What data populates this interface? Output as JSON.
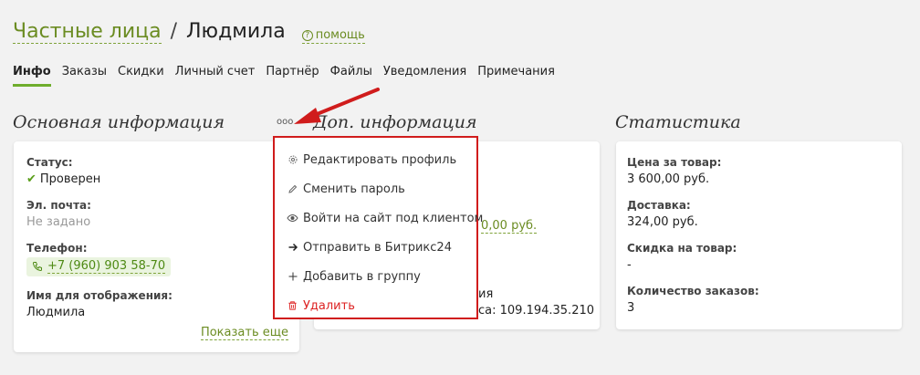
{
  "breadcrumb": {
    "parent": "Частные лица",
    "separator": "/",
    "current": "Людмила",
    "help_icon": "?",
    "help_label": "помощь"
  },
  "tabs": [
    {
      "label": "Инфо",
      "active": true
    },
    {
      "label": "Заказы"
    },
    {
      "label": "Скидки"
    },
    {
      "label": "Личный счет"
    },
    {
      "label": "Партнёр"
    },
    {
      "label": "Файлы"
    },
    {
      "label": "Уведомления"
    },
    {
      "label": "Примечания"
    }
  ],
  "main_info": {
    "title": "Основная информация",
    "status_label": "Статус:",
    "status_value": "Проверен",
    "email_label": "Эл. почта:",
    "email_value": "Не задано",
    "phone_label": "Телефон:",
    "phone_value": "+7 (960) 903 58-70",
    "display_name_label": "Имя для отображения:",
    "display_name_value": "Людмила",
    "show_more": "Показать еще",
    "menu_dots": "ooo"
  },
  "extra_info": {
    "title": "Доп. информация",
    "partial_amount": "0,00 руб.",
    "partial_label": "ия",
    "partial_ip": "са: 109.194.35.210"
  },
  "context_menu": [
    {
      "icon": "gear-icon",
      "label": "Редактировать профиль"
    },
    {
      "icon": "pencil-icon",
      "label": "Сменить пароль"
    },
    {
      "icon": "eye-icon",
      "label": "Войти на сайт под клиентом"
    },
    {
      "icon": "arrow-right-icon",
      "label": "Отправить в Битрикс24"
    },
    {
      "icon": "plus-icon",
      "label": "Добавить в группу"
    },
    {
      "icon": "trash-icon",
      "label": "Удалить",
      "danger": true
    }
  ],
  "stats": {
    "title": "Статистика",
    "items": [
      {
        "label": "Цена за товар:",
        "value": "3 600,00 руб."
      },
      {
        "label": "Доставка:",
        "value": "324,00 руб."
      },
      {
        "label": "Скидка на товар:",
        "value": "-"
      },
      {
        "label": "Количество заказов:",
        "value": "3"
      }
    ]
  },
  "colors": {
    "accent_green": "#6fae2d",
    "link_green": "#6b8c22",
    "highlight_red": "#d01c1c"
  }
}
